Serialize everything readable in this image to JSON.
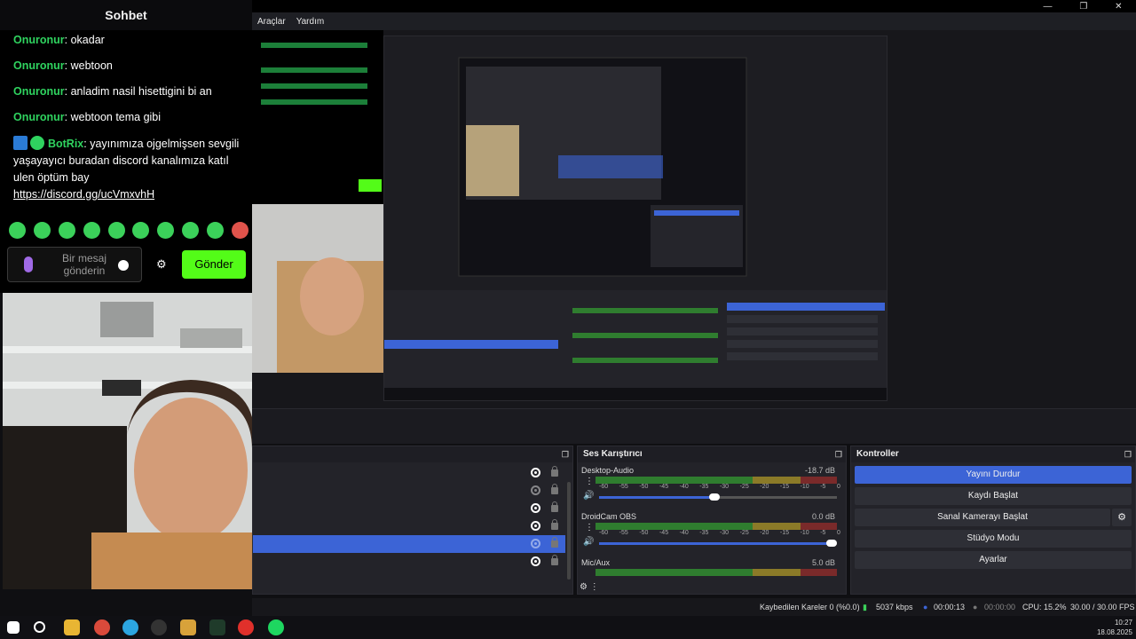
{
  "obs": {
    "menu": [
      "Araçlar",
      "Yardım"
    ],
    "docks": {
      "mixer_title": "Ses Karıştırıcı",
      "controls_title": "Kontroller"
    },
    "mixer": {
      "channels": [
        {
          "name": "Desktop-Audio",
          "db": "-18.7 dB"
        },
        {
          "name": "DroidCam OBS",
          "db": "0.0 dB"
        },
        {
          "name": "Mic/Aux",
          "db": "5.0 dB"
        }
      ],
      "ticks": [
        "-60",
        "-55",
        "-50",
        "-45",
        "-40",
        "-35",
        "-30",
        "-25",
        "-20",
        "-15",
        "-10",
        "-5",
        "0"
      ]
    },
    "controls": {
      "stop_stream": "Yayını Durdur",
      "start_record": "Kaydı Başlat",
      "start_virtualcam": "Sanal Kamerayı Başlat",
      "studio_mode": "Stüdyo Modu",
      "settings": "Ayarlar"
    },
    "status": {
      "dropped": "Kaybedilen Kareler 0 (%0.0)",
      "bitrate": "5037 kbps",
      "stream_time": "00:00:13",
      "record_time": "00:00:00",
      "cpu": "CPU: 15.2%",
      "fps": "30.00 / 30.00 FPS"
    },
    "colors": {
      "accent": "#3c64d6",
      "send": "#53fc18",
      "user": "#2fd35f"
    }
  },
  "chat": {
    "title": "Sohbet",
    "messages": [
      {
        "user": "Onuronur",
        "text": ": okadar"
      },
      {
        "user": "Onuronur",
        "text": ": webtoon"
      },
      {
        "user": "Onuronur",
        "text": ": anladim nasil hisettigini bi an"
      },
      {
        "user": "Onuronur",
        "text": ": webtoon tema gibi"
      }
    ],
    "bot": {
      "user": "BotRix",
      "text": ": yayınımıza ojgelmişsen sevgili yaşayayıcı buradan discord kanalımıza katıl ulen öptüm bay",
      "link": "https://discord.gg/ucVmxvhH"
    },
    "input_placeholder": "Bir mesaj gönderin",
    "send_label": "Gönder"
  },
  "taskbar": {
    "time": "10:27",
    "date": "18.08.2025"
  }
}
